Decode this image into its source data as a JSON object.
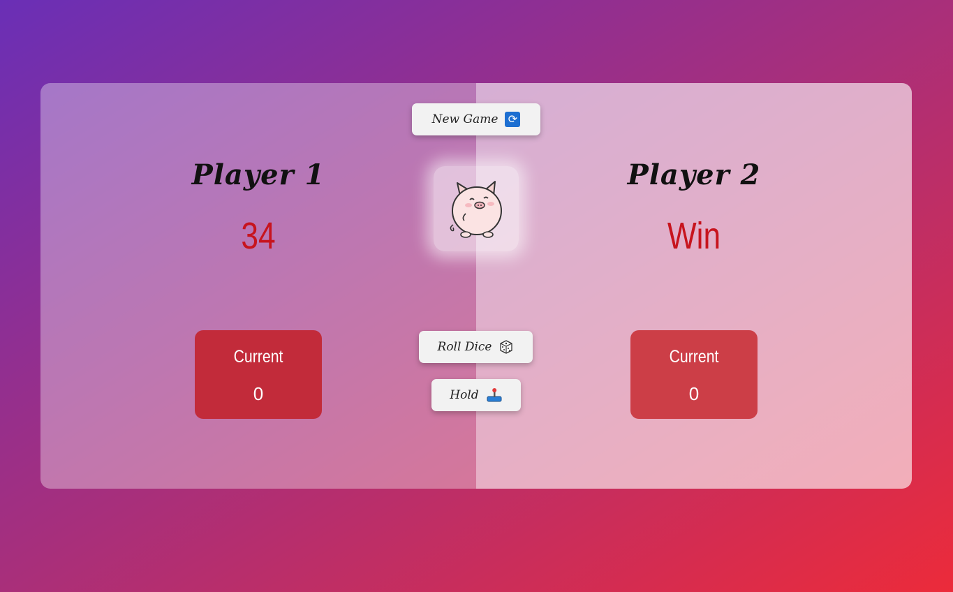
{
  "players": [
    {
      "name": "Player 1",
      "score": "34",
      "current_label": "Current",
      "current_score": "0"
    },
    {
      "name": "Player 2",
      "score": "Win",
      "current_label": "Current",
      "current_score": "0"
    }
  ],
  "controls": {
    "new_game_label": "New Game",
    "roll_label": "Roll Dice",
    "hold_label": "Hold"
  },
  "icons": {
    "new_game": "refresh-icon",
    "roll": "dice-icon",
    "hold": "joystick-icon",
    "dice_face": "pig-icon"
  },
  "colors": {
    "score": "#c7141e",
    "current_box_p1": "#c22b3a",
    "current_box_p2": "#cc3e47",
    "refresh_icon": "#1d6fd1"
  }
}
